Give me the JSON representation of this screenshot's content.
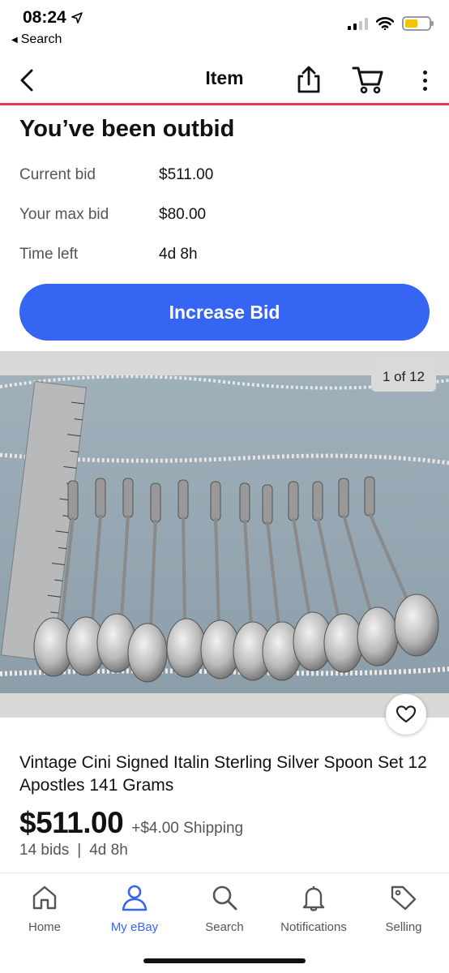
{
  "status": {
    "time": "08:24",
    "back_app": "Search"
  },
  "header": {
    "title": "Item"
  },
  "bid": {
    "heading": "You’ve been outbid",
    "rows": [
      {
        "label": "Current bid",
        "value": "$511.00"
      },
      {
        "label": "Your max bid",
        "value": "$80.00"
      },
      {
        "label": "Time left",
        "value": "4d 8h"
      }
    ],
    "button_label": "Increase Bid"
  },
  "photo": {
    "counter": "1 of 12"
  },
  "listing": {
    "title": "Vintage Cini Signed Italin Sterling Silver Spoon Set 12 Apostles 141 Grams",
    "price": "$511.00",
    "shipping": "+$4.00 Shipping",
    "bids": "14 bids",
    "separator": "|",
    "time_left": "4d 8h"
  },
  "tabs": [
    {
      "label": "Home",
      "icon": "home-icon",
      "active": false
    },
    {
      "label": "My eBay",
      "icon": "person-icon",
      "active": true
    },
    {
      "label": "Search",
      "icon": "search-icon",
      "active": false
    },
    {
      "label": "Notifications",
      "icon": "bell-icon",
      "active": false
    },
    {
      "label": "Selling",
      "icon": "tag-icon",
      "active": false
    }
  ],
  "colors": {
    "accent": "#3665f3",
    "header_divider": "#e0394f",
    "battery": "#f5c400"
  }
}
